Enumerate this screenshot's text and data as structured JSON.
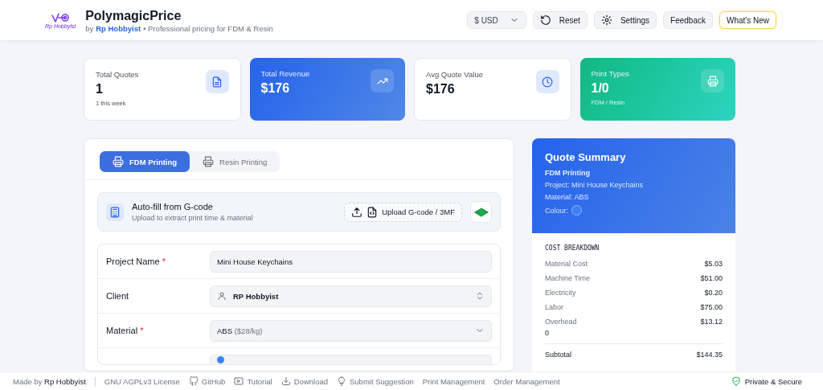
{
  "header": {
    "title": "PolymagicPrice",
    "logo_caption": "Rp Hobbyist",
    "byline": {
      "prefix": "by",
      "author": "Rp Hobbyist",
      "tagline": "• Professional pricing for FDM & Resin"
    },
    "actions": [
      {
        "kind": "select",
        "label": "$ USD"
      },
      {
        "kind": "button",
        "label": "Reset"
      },
      {
        "kind": "button",
        "label": "Settings"
      },
      {
        "kind": "plain",
        "label": "Feedback"
      },
      {
        "kind": "highlight",
        "label": "What's New"
      }
    ]
  },
  "stats": [
    {
      "kind": "plain",
      "label": "Total Quotes",
      "value": "1",
      "note": "1 this week"
    },
    {
      "kind": "blue",
      "label": "Total Revenue",
      "value": "$176"
    },
    {
      "kind": "plain",
      "label": "Avg Quote Value",
      "value": "$176"
    },
    {
      "kind": "green",
      "label": "Print Types",
      "value": "1/0",
      "note": "FDM / Resin"
    }
  ],
  "tabs": [
    {
      "label": "FDM Printing",
      "selected": true
    },
    {
      "label": "Resin Printing",
      "selected": false
    }
  ],
  "autofill": {
    "title": "Auto-fill from G-code",
    "subtitle": "Upload to extract print time & material",
    "upload": "Upload G-code / 3MF"
  },
  "form": [
    {
      "kind": "text",
      "label": "Project Name",
      "required_mark": "*",
      "value": "Mini House Keychains"
    },
    {
      "kind": "client",
      "label": "Client",
      "value": "RP Hobbyist"
    },
    {
      "kind": "select",
      "label": "Material",
      "required_mark": "*",
      "value": "ABS",
      "hint": "($28/kg)"
    },
    {
      "kind": "spool"
    }
  ],
  "summary": {
    "title": "Quote Summary",
    "type": "FDM Printing",
    "project": "Project: Mini House Keychains",
    "material": "Material: ABS",
    "colour": "Colour:",
    "breakdown_title": "COST BREAKDOWN",
    "rows": [
      {
        "label": "Material Cost",
        "value": "$5.03"
      },
      {
        "label": "Machine Time",
        "value": "$51.00"
      },
      {
        "label": "Electricity",
        "value": "$0.20"
      },
      {
        "label": "Labor",
        "value": "$75.00"
      },
      {
        "label": "Overhead",
        "value": "$13.12",
        "note": "0"
      }
    ],
    "subtotal": {
      "label": "Subtotal",
      "value": "$144.35"
    }
  },
  "footer": {
    "credit": "Made by **Rp Hobbyist**",
    "links": [
      {
        "kind": "none",
        "label": "GNU AGPLv3 License"
      },
      {
        "kind": "github",
        "label": "GitHub"
      },
      {
        "kind": "video",
        "label": "Tutorial"
      },
      {
        "kind": "download",
        "label": "Download"
      },
      {
        "kind": "bulb",
        "label": "Submit Suggestion"
      },
      {
        "kind": "none",
        "label": "Print Management"
      },
      {
        "kind": "none",
        "label": "Order Management"
      }
    ],
    "privacy": "Private & Secure"
  }
}
